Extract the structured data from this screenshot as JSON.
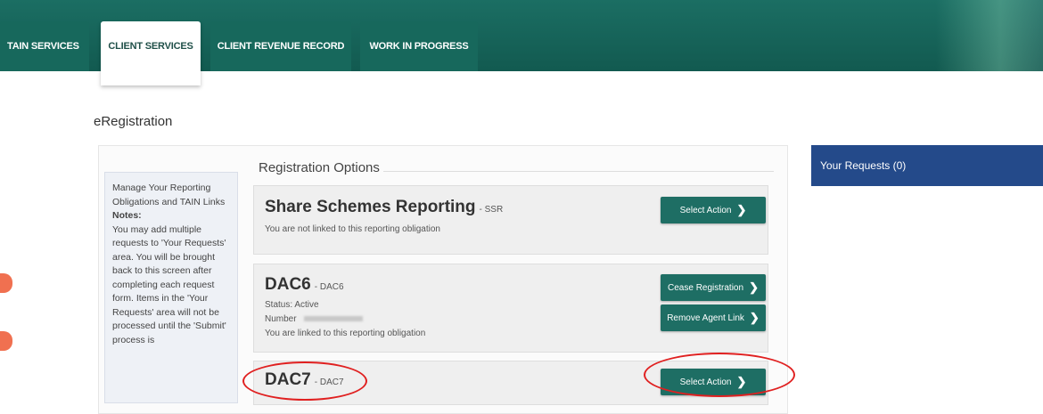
{
  "tabs": [
    {
      "label": "TAIN SERVICES",
      "active": false
    },
    {
      "label": "CLIENT SERVICES",
      "active": true
    },
    {
      "label": "CLIENT REVENUE RECORD",
      "active": false
    },
    {
      "label": "WORK IN PROGRESS",
      "active": false
    }
  ],
  "page_title": "eRegistration",
  "notes": {
    "intro": "Manage Your Reporting Obligations and TAIN Links",
    "heading": "Notes:",
    "lines": "You may add multiple requests to 'Your Requests' area. You will be brought back to this screen after completing each request form. Items in the 'Your Requests' area will not be processed until the 'Submit' process is"
  },
  "registration": {
    "legend": "Registration Options",
    "options": [
      {
        "title": "Share Schemes Reporting",
        "code": "- SSR",
        "linked_text": "You are not linked to this reporting obligation",
        "buttons": [
          "Select Action"
        ]
      },
      {
        "title": "DAC6",
        "code": "- DAC6",
        "status": "Status: Active",
        "number_label": "Number",
        "linked_text": "You are linked to this reporting obligation",
        "buttons": [
          "Cease Registration",
          "Remove Agent Link"
        ]
      },
      {
        "title": "DAC7",
        "code": "- DAC7",
        "buttons": [
          "Select Action"
        ]
      }
    ]
  },
  "requests": {
    "title": "Your Requests (0)"
  },
  "colors": {
    "topbar": "#1b6e63",
    "button": "#1e6e64",
    "requests_header": "#244a8a",
    "annotation": "#e02020"
  }
}
